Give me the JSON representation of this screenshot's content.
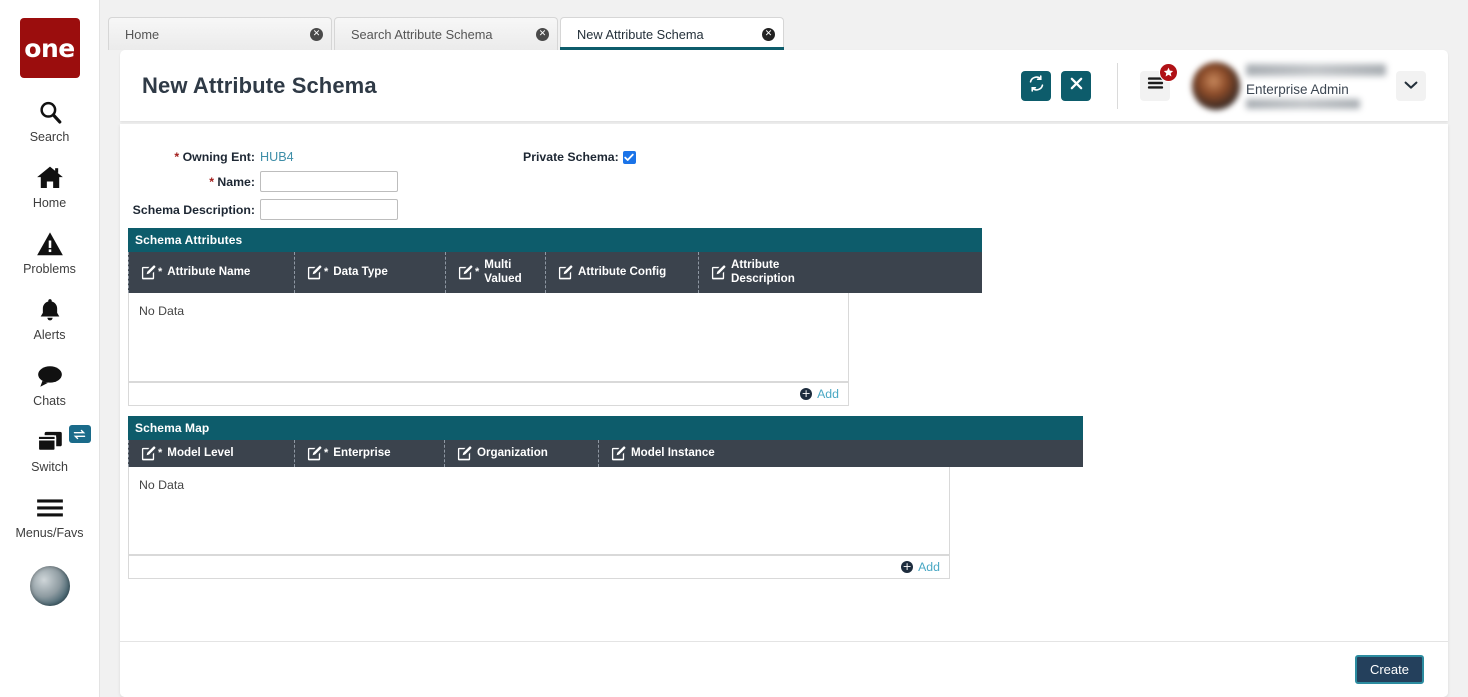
{
  "brand": {
    "logo_text": "one",
    "logo_color": "#9b0d0d"
  },
  "sidebar": {
    "items": [
      {
        "label": "Search",
        "icon": "search-icon"
      },
      {
        "label": "Home",
        "icon": "home-icon"
      },
      {
        "label": "Problems",
        "icon": "warning-triangle-icon"
      },
      {
        "label": "Alerts",
        "icon": "bell-icon"
      },
      {
        "label": "Chats",
        "icon": "chat-bubble-icon"
      },
      {
        "label": "Switch",
        "icon": "windows-stack-icon",
        "badge_icon": "swap-arrows-icon"
      },
      {
        "label": "Menus/Favs",
        "icon": "hamburger-icon"
      }
    ],
    "avatar": "user-avatar-icon"
  },
  "tabs": [
    {
      "label": "Home",
      "active": false,
      "close_icon": "close-circle-icon"
    },
    {
      "label": "Search Attribute Schema",
      "active": false,
      "close_icon": "close-circle-icon"
    },
    {
      "label": "New Attribute Schema",
      "active": true,
      "close_icon": "close-circle-icon"
    }
  ],
  "header": {
    "title": "New Attribute Schema",
    "refresh_icon": "refresh-icon",
    "close_icon": "close-x-icon",
    "menu_icon": "hamburger-menu-icon",
    "menu_badge_icon": "star-icon",
    "user_role": "Enterprise Admin",
    "chevron_icon": "chevron-down-icon",
    "accent_color": "#0d5c6b",
    "badge_color": "#b01116"
  },
  "form": {
    "owning_ent": {
      "required": true,
      "label": "Owning Ent:",
      "value": "HUB4"
    },
    "name": {
      "required": true,
      "label": "Name:",
      "value": "",
      "placeholder": ""
    },
    "schema_description": {
      "required": false,
      "label": "Schema Description:",
      "value": "",
      "placeholder": ""
    },
    "private_schema": {
      "label": "Private Schema:",
      "checked": true,
      "check_icon": "checkmark-icon"
    }
  },
  "schema_attributes": {
    "title": "Schema Attributes",
    "columns": [
      {
        "label": "Attribute Name",
        "required": true,
        "icon": "pencil-edit-icon"
      },
      {
        "label": "Data Type",
        "required": true,
        "icon": "pencil-edit-icon"
      },
      {
        "label": "Multi Valued",
        "required": true,
        "icon": "pencil-edit-icon"
      },
      {
        "label": "Attribute Config",
        "required": false,
        "icon": "pencil-edit-icon"
      },
      {
        "label": "Attribute Description",
        "required": false,
        "icon": "pencil-edit-icon"
      }
    ],
    "rows": [],
    "empty_text": "No Data",
    "add_label": "Add",
    "add_icon": "plus-circle-icon"
  },
  "schema_map": {
    "title": "Schema Map",
    "columns": [
      {
        "label": "Model Level",
        "required": true,
        "icon": "pencil-edit-icon"
      },
      {
        "label": "Enterprise",
        "required": true,
        "icon": "pencil-edit-icon"
      },
      {
        "label": "Organization",
        "required": false,
        "icon": "pencil-edit-icon"
      },
      {
        "label": "Model Instance",
        "required": false,
        "icon": "pencil-edit-icon"
      }
    ],
    "rows": [],
    "empty_text": "No Data",
    "add_label": "Add",
    "add_icon": "plus-circle-icon"
  },
  "footer": {
    "create_label": "Create"
  }
}
